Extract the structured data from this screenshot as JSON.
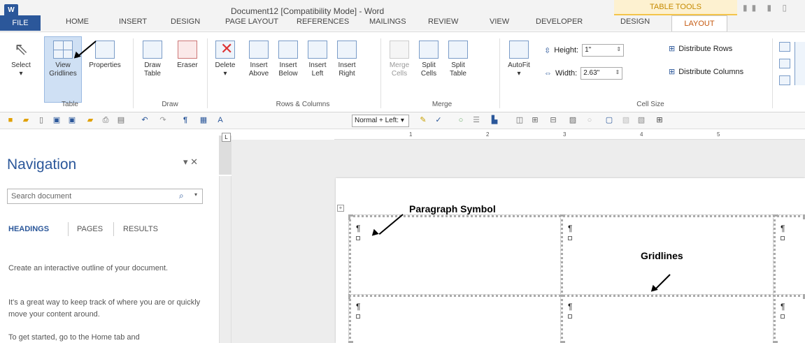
{
  "window": {
    "title": "Document12 [Compatibility Mode] - Word",
    "logo": "W",
    "context_group": "TABLE TOOLS",
    "tabs": [
      "FILE",
      "HOME",
      "INSERT",
      "DESIGN",
      "PAGE LAYOUT",
      "REFERENCES",
      "MAILINGS",
      "REVIEW",
      "VIEW",
      "DEVELOPER",
      "DESIGN",
      "LAYOUT"
    ],
    "active_tab": "LAYOUT"
  },
  "ribbon": {
    "table_group": {
      "label": "Table",
      "buttons": {
        "select": "Select",
        "view_gridlines": [
          "View",
          "Gridlines"
        ],
        "properties": "Properties"
      }
    },
    "draw_group": {
      "label": "Draw",
      "buttons": {
        "draw_table": [
          "Draw",
          "Table"
        ],
        "eraser": "Eraser"
      }
    },
    "rows_cols_group": {
      "label": "Rows & Columns",
      "buttons": {
        "delete": "Delete",
        "insert_above": [
          "Insert",
          "Above"
        ],
        "insert_below": [
          "Insert",
          "Below"
        ],
        "insert_left": [
          "Insert",
          "Left"
        ],
        "insert_right": [
          "Insert",
          "Right"
        ]
      }
    },
    "merge_group": {
      "label": "Merge",
      "buttons": {
        "merge_cells": [
          "Merge",
          "Cells"
        ],
        "split_cells": [
          "Split",
          "Cells"
        ],
        "split_table": [
          "Split",
          "Table"
        ]
      }
    },
    "autofit": "AutoFit",
    "cell_size_group": {
      "label": "Cell Size",
      "height_label": "Height:",
      "height_value": "1\"",
      "width_label": "Width:",
      "width_value": "2.63\"",
      "distribute_rows": "Distribute Rows",
      "distribute_columns": "Distribute Columns"
    }
  },
  "qat": {
    "style_value": "Normal + Left:"
  },
  "navigation": {
    "title": "Navigation",
    "search_placeholder": "Search document",
    "tabs": [
      "HEADINGS",
      "PAGES",
      "RESULTS"
    ],
    "text1": "Create an interactive outline of your document.",
    "text2": "It's a great way to keep track of where you are or quickly move your content around.",
    "text3": "To get started, go to the Home tab and"
  },
  "ruler": {
    "numbers": [
      "1",
      "2",
      "3",
      "4",
      "5"
    ]
  },
  "document": {
    "pilcrow": "¶",
    "annotation_paragraph": "Paragraph Symbol",
    "annotation_gridlines": "Gridlines"
  }
}
